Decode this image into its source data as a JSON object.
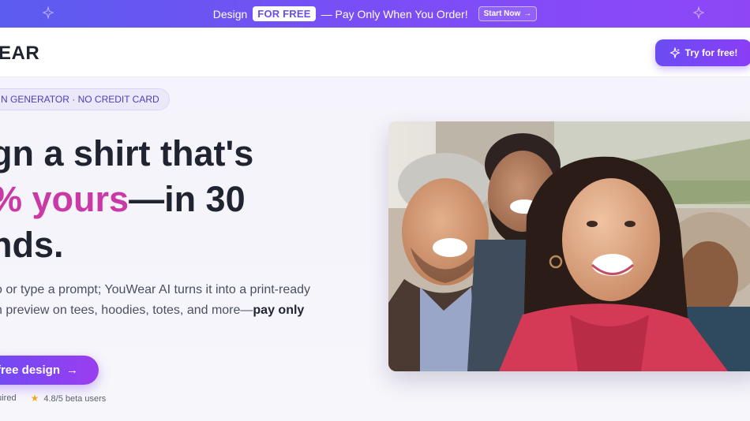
{
  "promo": {
    "text_before": "Design",
    "highlight": "FOR FREE",
    "text_after": "— Pay Only When You Order!",
    "start_button": "Start Now",
    "start_arrow": "→"
  },
  "nav": {
    "logo": "EAR",
    "try_button": "Try for free!"
  },
  "hero": {
    "badge": "N GENERATOR · NO CREDIT CARD",
    "headline_line1": "gn a shirt that's",
    "headline_accent": "% yours",
    "headline_line2_rest": "—in 30",
    "headline_line3": "nds.",
    "desc_line1": "o or type a prompt; YouWear AI turns it into a print-ready",
    "desc_line2_start": "n preview on tees, hoodies, totes, and more—",
    "desc_bold": "pay only",
    "cta": "free design",
    "cta_arrow": "→",
    "meta_left": "quired",
    "rating_star": "★",
    "rating": "4.8/5 beta users"
  },
  "colors": {
    "promo_gradient_start": "#5b5cf0",
    "promo_gradient_end": "#8f47f6",
    "accent_pink": "#c93aa6",
    "button_purple": "#6d4cf3"
  },
  "icons": {
    "promo_sparkle": "sparkle-icon",
    "try_icon": "sparkle-icon",
    "arrow": "arrow-right-icon",
    "star": "star-icon"
  }
}
